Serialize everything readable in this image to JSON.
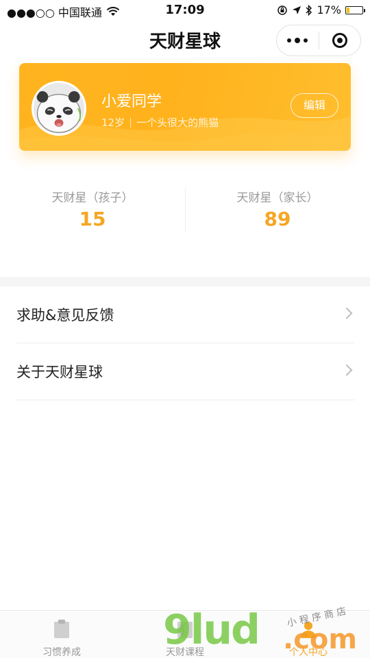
{
  "status_bar": {
    "carrier": "●●●○○ 中国联通",
    "time": "17:09",
    "battery_text": "17%",
    "battery_level": 0.17
  },
  "nav": {
    "title": "天财星球"
  },
  "profile": {
    "name": "小爱同学",
    "age": "12岁",
    "bio": "一个头很大的熊猫",
    "edit_label": "编辑"
  },
  "stats": [
    {
      "label": "天财星（孩子）",
      "value": "15"
    },
    {
      "label": "天财星（家长）",
      "value": "89"
    }
  ],
  "menu": [
    {
      "label": "求助&意见反馈"
    },
    {
      "label": "关于天财星球"
    }
  ],
  "tabbar": [
    {
      "label": "习惯养成",
      "icon": "clipboard-icon"
    },
    {
      "label": "天财课程",
      "icon": "book-icon"
    },
    {
      "label": "个人中心",
      "icon": "person-icon"
    }
  ],
  "watermark": {
    "main": "9lud",
    "com": ".com",
    "small": "小 程 序 商 店"
  },
  "colors": {
    "accent": "#f5a623",
    "card": "#ffb41f"
  }
}
